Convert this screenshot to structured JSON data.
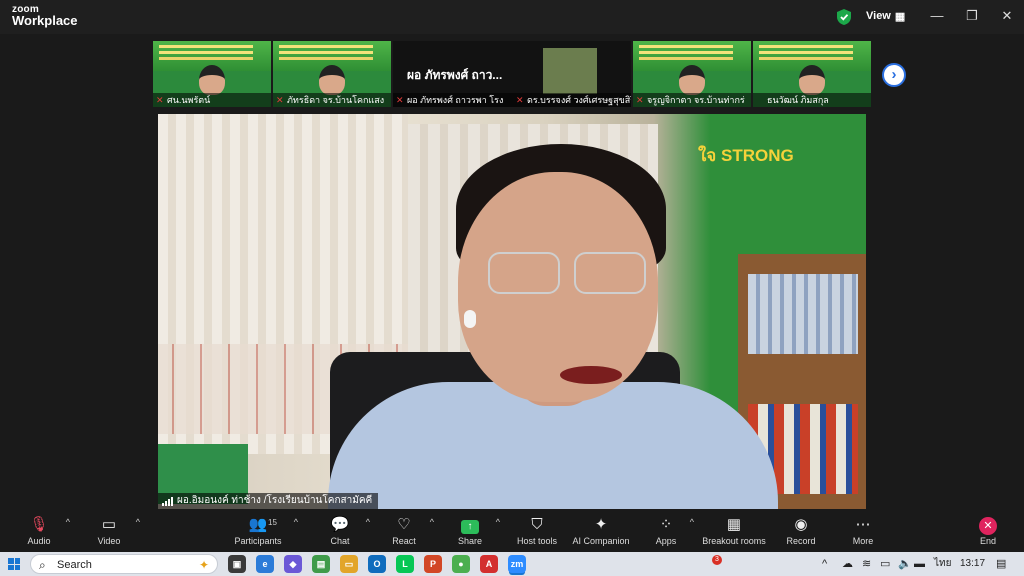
{
  "app": {
    "brand_top": "zoom",
    "brand_bottom": "Workplace",
    "view_label": "View"
  },
  "window_controls": {
    "minimize": "—",
    "maximize": "❐",
    "close": "✕"
  },
  "gallery": {
    "tiles": [
      {
        "name": "ศน.นพรัตน์",
        "muted": true
      },
      {
        "name": "ภัทรธิดา จร.บ้านโคกแสง",
        "muted": true
      },
      {
        "name": "ผอ ภัทรพงศ์ ถาวรพา โรง",
        "muted": true,
        "big_name": "ผอ ภัทรพงศ์ ถาว..."
      },
      {
        "name": "ดร.บรรจงศ์ วงศ์เศรษฐสุขสิริ",
        "muted": true
      },
      {
        "name": "จรูญจิกาตา จร.บ้านท่ากร่",
        "muted": true
      },
      {
        "name": "ธนวัฒน์ ภิมสกุล",
        "muted": false
      }
    ],
    "next_icon": "›"
  },
  "main_video": {
    "speaker_label": "ผอ.อิมอนงค์ ท่าช้าง /โรงเรียนบ้านโคกสามัคคี",
    "banner_line2": "ใจ STRONG"
  },
  "toolbar": {
    "audio": "Audio",
    "video": "Video",
    "participants": "Participants",
    "participants_count": "15",
    "chat": "Chat",
    "react": "React",
    "share": "Share",
    "host_tools": "Host tools",
    "ai_companion": "AI Companion",
    "apps": "Apps",
    "breakout_rooms": "Breakout rooms",
    "record": "Record",
    "more": "More",
    "end": "End"
  },
  "taskbar": {
    "search_placeholder": "Search",
    "notification_count": "3",
    "language": "ไทย",
    "time": "13:17"
  },
  "colors": {
    "share_green": "#2cbc5a",
    "end_red": "#e0245e",
    "tile_green": "#2c8a3c",
    "accent_blue": "#2a6fe0"
  }
}
